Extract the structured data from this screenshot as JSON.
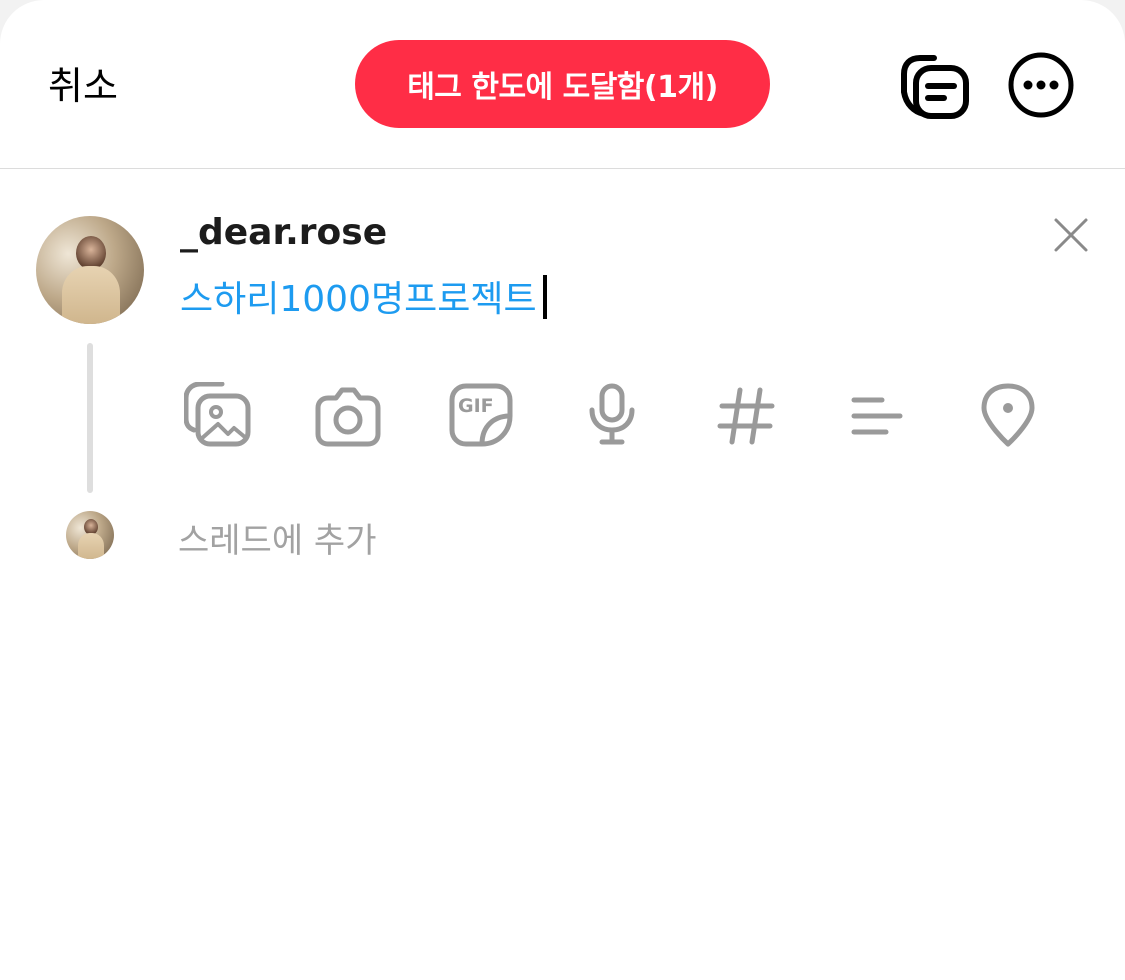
{
  "header": {
    "cancel_label": "취소",
    "notice_label": "태그 한도에 도달함(1개)",
    "notice_color": "#ff2d46",
    "icons": [
      "drafts-icon",
      "more-options-icon"
    ]
  },
  "post": {
    "username": "_dear.rose",
    "text": "스하리1000명프로젝트",
    "text_color": "#1d9bf0"
  },
  "toolbar": {
    "icons": [
      "gallery-icon",
      "camera-icon",
      "gif-icon",
      "microphone-icon",
      "hashtag-icon",
      "poll-icon",
      "location-icon"
    ],
    "gif_label": "GIF"
  },
  "thread": {
    "add_placeholder": "스레드에 추가"
  }
}
